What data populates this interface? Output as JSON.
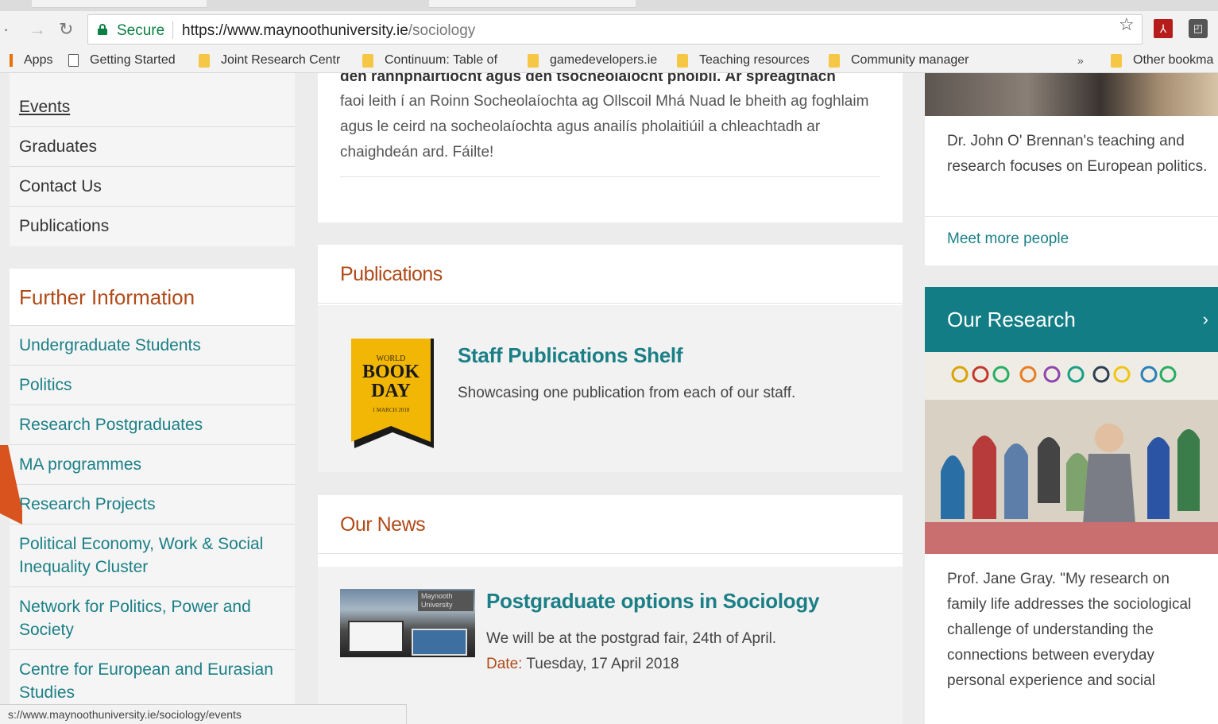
{
  "browser": {
    "secure_label": "Secure",
    "url_host": "https://www.maynoothuniversity.ie",
    "url_path": "/sociology",
    "bookmarks": [
      {
        "label": "Apps",
        "icon": "apps-icon"
      },
      {
        "label": "Getting Started",
        "icon": "page-icon"
      },
      {
        "label": "Joint Research Centr",
        "icon": "folder-icon"
      },
      {
        "label": "Continuum: Table of",
        "icon": "folder-icon"
      },
      {
        "label": "gamedevelopers.ie",
        "icon": "folder-icon"
      },
      {
        "label": "Teaching resources",
        "icon": "folder-icon"
      },
      {
        "label": "Community manager",
        "icon": "folder-icon"
      },
      {
        "label": "Other bookma",
        "icon": "folder-icon"
      }
    ],
    "bookmarks_more": "»",
    "status_url": "s://www.maynoothuniversity.ie/sociology/events"
  },
  "left_nav": {
    "items": [
      "Events",
      "Graduates",
      "Contact Us",
      "Publications"
    ]
  },
  "further_info": {
    "title": "Further Information",
    "items": [
      "Undergraduate Students",
      "Politics",
      "Research Postgraduates",
      "MA programmes",
      "Research Projects",
      "Political Economy, Work & Social Inequality Cluster",
      "Network for Politics, Power and Society",
      "Centre for European and Eurasian Studies"
    ]
  },
  "intro": {
    "cut_line": "den rannpháirtíocht agus den tsocheolaíocht phoiblí. Ár spreagthach",
    "text": "faoi leith í an Roinn Socheolaíochta ag Ollscoil Mhá Nuad le bheith ag foghlaim agus le ceird na socheolaíochta agus anailís pholaitiúil a chleachtadh ar chaighdeán ard.  Fáilte!"
  },
  "publications": {
    "heading": "Publications",
    "item_title": "Staff Publications Shelf",
    "item_desc": "Showcasing one publication from each of our staff.",
    "badge_top": "WORLD",
    "badge_main1": "BOOK",
    "badge_main2": "DAY",
    "badge_date": "1 MARCH 2018"
  },
  "news": {
    "heading": "Our News",
    "item_title": "Postgraduate options in Sociology",
    "item_desc": "We will be at the postgrad fair, 24th of April.",
    "date_label": "Date:",
    "date_value": "Tuesday, 17 April 2018",
    "thumb_sign": "Maynooth University"
  },
  "right": {
    "profile_text": "Dr. John O' Brennan's teaching and research focuses on European politics.",
    "meet_link": "Meet more people",
    "research_heading": "Our Research",
    "research_chevron": "›",
    "research_text": "Prof. Jane Gray. \"My research on family life addresses the sociological challenge of understanding the connections between everyday personal experience and social"
  },
  "colors": {
    "accent_orange": "#b04a18",
    "link_teal": "#1b7f86",
    "research_header": "#137d86",
    "book_day_yellow": "#f2b705",
    "annotation_arrow": "#d9531e"
  }
}
